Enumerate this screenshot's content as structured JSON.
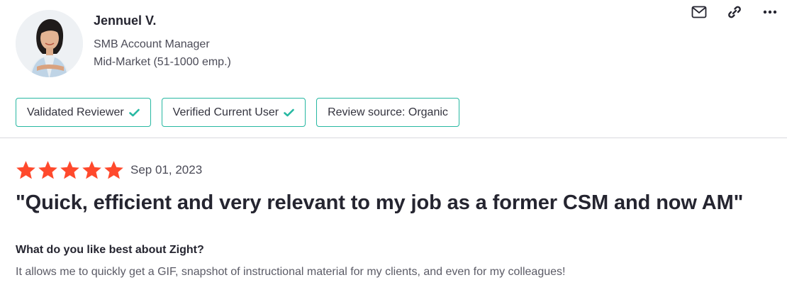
{
  "reviewer": {
    "name": "Jennuel V.",
    "role": "SMB Account Manager",
    "company_size": "Mid-Market (51-1000 emp.)",
    "avatar_icon": "person-photo-avatar"
  },
  "actions": {
    "email_icon": "envelope-icon",
    "link_icon": "link-icon",
    "more_icon": "more-dots-icon"
  },
  "badges": [
    {
      "label": "Validated Reviewer",
      "checked": true
    },
    {
      "label": "Verified Current User",
      "checked": true
    },
    {
      "label": "Review source: Organic",
      "checked": false
    }
  ],
  "review": {
    "rating": 5,
    "max_rating": 5,
    "date": "Sep 01, 2023",
    "title": "\"Quick, efficient and very relevant to my job as a former CSM and now AM\"",
    "question": "What do you like best about Zight?",
    "answer": "It allows me to quickly get a GIF, snapshot of instructional material for my clients, and even for my colleagues!"
  },
  "colors": {
    "star": "#ff492c",
    "badge_border": "#27b8a2",
    "check": "#27b8a2",
    "text_primary": "#252530",
    "text_secondary": "#5b5b66"
  }
}
